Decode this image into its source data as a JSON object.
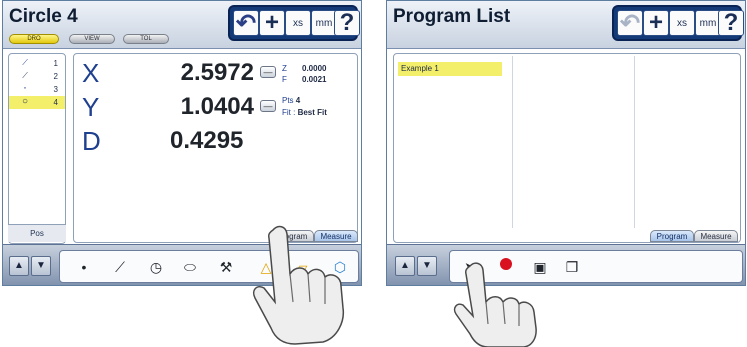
{
  "left_screen": {
    "title": "Circle 4",
    "modes": [
      "DRO",
      "VIEW",
      "TOL"
    ],
    "toolbar": {
      "undo": "↶",
      "add": "+",
      "xs": "xs",
      "units": "mm",
      "help": "?"
    },
    "features": [
      {
        "icon": "line",
        "glyph": "⟋",
        "number": "1"
      },
      {
        "icon": "line",
        "glyph": "⟋",
        "number": "2"
      },
      {
        "icon": "point",
        "glyph": "·",
        "number": "3"
      },
      {
        "icon": "circle",
        "glyph": "○",
        "number": "4"
      }
    ],
    "pos_label": "Pos",
    "dro": {
      "x": {
        "label": "X",
        "value": "2.5972"
      },
      "y": {
        "label": "Y",
        "value": "1.0404"
      },
      "d": {
        "label": "D",
        "value": "0.4295"
      },
      "z_label": "Z",
      "z_value": "0.0000",
      "f_label": "F",
      "f_value": "0.0021",
      "pts_label": "Pts",
      "pts_value": "4",
      "fit_label": "Fit :",
      "fit_value": "Best Fit"
    },
    "tabs": [
      "Program",
      "Measure"
    ],
    "tools": [
      "point-tool-icon",
      "line-tool-icon",
      "circle-tool-icon",
      "slot-tool-icon",
      "distance-tool-icon",
      "angle-tool-icon",
      "plane-tool-icon",
      "rectangle-tool-icon"
    ]
  },
  "right_screen": {
    "title": "Program List",
    "program_items": [
      "Example 1"
    ],
    "tabs": [
      "Program",
      "Measure"
    ],
    "tools": [
      "cursor-icon",
      "record-icon",
      "program-icon",
      "copy-icon"
    ],
    "record_color": "#d81020"
  }
}
